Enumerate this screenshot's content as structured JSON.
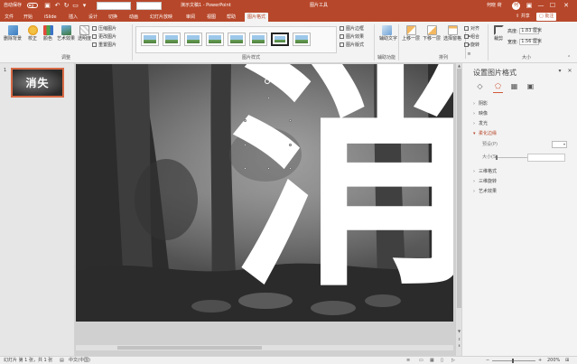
{
  "titlebar": {
    "autosave_label": "自动保存",
    "autosave_state": "关",
    "doc_title": "演示文稿1 - PowerPoint",
    "tools_label": "图片工具",
    "user_name": "何晓 荷",
    "user_initials": "何"
  },
  "tabs": [
    "文件",
    "开始",
    "iSlide",
    "插入",
    "设计",
    "切换",
    "动画",
    "幻灯片放映",
    "审阅",
    "视图",
    "帮助"
  ],
  "active_tab": "图片格式",
  "share_label": "共享",
  "comment_label": "批注",
  "ribbon": {
    "remove_bg": "删除背景",
    "corrections": "校正",
    "color": "颜色",
    "artistic": "艺术效果",
    "transparency": "透明度",
    "compress": "压缩图片",
    "change_pic": "更改图片",
    "reset_pic": "重置图片",
    "group_adjust": "调整",
    "group_styles": "图片样式",
    "pic_border": "图片边框",
    "pic_effects": "图片效果",
    "pic_layout": "图片版式",
    "alt_text": "辅助文字",
    "group_access": "辅助功能",
    "bring_forward": "上移一层",
    "send_backward": "下移一层",
    "selection_pane": "选择窗格",
    "align": "对齐",
    "group": "组合",
    "rotate": "旋转",
    "group_arrange": "排列",
    "crop": "裁剪",
    "height_label": "高度:",
    "height_value": "1.83 厘米",
    "width_label": "宽度:",
    "width_value": "1.56 厘米",
    "group_size": "大小"
  },
  "slide_panel": {
    "slide_number": "1",
    "thumb_text": "消失"
  },
  "slide": {
    "big_char": "消"
  },
  "format_panel": {
    "title": "设置图片格式",
    "sections": [
      "阴影",
      "映像",
      "发光",
      "柔化边缘",
      "三维格式",
      "三维旋转",
      "艺术效果"
    ],
    "open_section": "柔化边缘",
    "preset_label": "预设(P)",
    "size_label": "大小(S)"
  },
  "statusbar": {
    "slide_info": "幻灯片 第 1 张，共 1 张",
    "language": "中文(中国)",
    "zoom": "200%"
  },
  "colors": {
    "accent": "#b7472a",
    "panel_open": "#d0583a"
  }
}
